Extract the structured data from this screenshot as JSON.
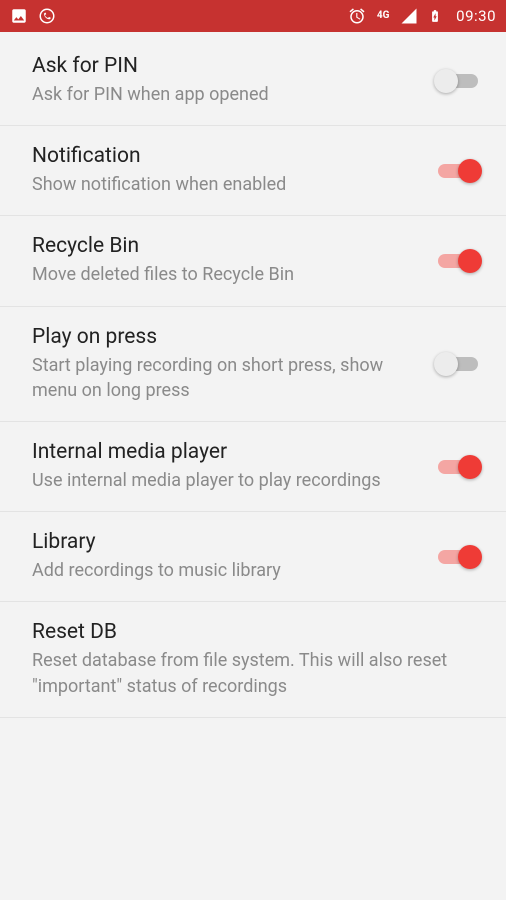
{
  "status": {
    "time": "09:30",
    "network": "4G"
  },
  "settings": [
    {
      "title": "Ask for PIN",
      "desc": "Ask for PIN when app opened",
      "toggle": true,
      "on": false
    },
    {
      "title": "Notification",
      "desc": "Show notification when enabled",
      "toggle": true,
      "on": true
    },
    {
      "title": "Recycle Bin",
      "desc": "Move deleted files to Recycle Bin",
      "toggle": true,
      "on": true
    },
    {
      "title": "Play on press",
      "desc": "Start playing recording on short press, show menu on long press",
      "toggle": true,
      "on": false
    },
    {
      "title": "Internal media player",
      "desc": "Use internal media player to play recordings",
      "toggle": true,
      "on": true
    },
    {
      "title": "Library",
      "desc": "Add recordings to music library",
      "toggle": true,
      "on": true
    },
    {
      "title": "Reset DB",
      "desc": "Reset database from file system. This will also reset \"important\" status of recordings",
      "toggle": false,
      "on": false
    }
  ]
}
